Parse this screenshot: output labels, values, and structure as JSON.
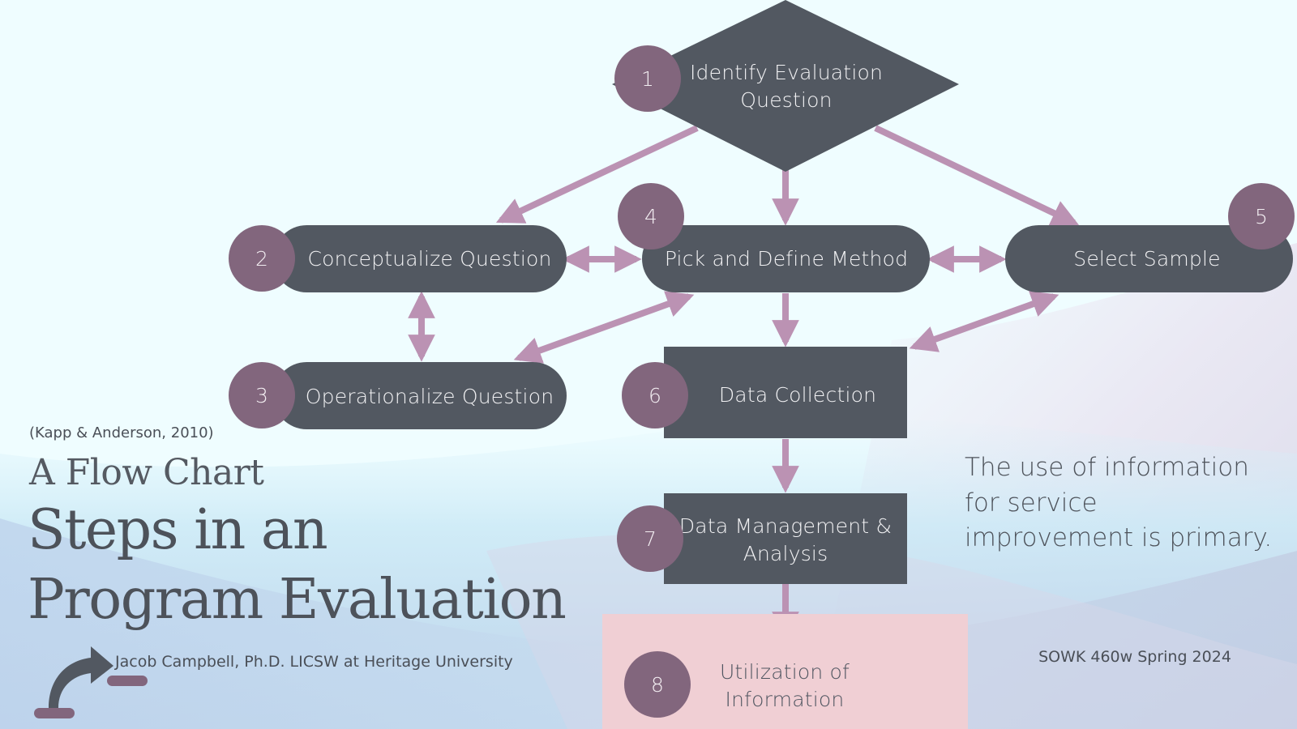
{
  "colors": {
    "background": "#effdff",
    "node_fill": "#525861",
    "badge_fill": "#82667d",
    "arrow": "#bb92b3",
    "highlight_box": "#f0cfd4",
    "text_dark": "#4d525a",
    "text_light": "#f2f2f4"
  },
  "slide": {
    "citation": "(Kapp & Anderson, 2010)",
    "subtitle": "A Flow Chart",
    "title_line1": "Steps in an",
    "title_line2": "Program Evaluation",
    "author": "Jacob Campbell, Ph.D. LICSW at Heritage University",
    "side_note": "The use of information for service improvement is primary.",
    "course": "SOWK 460w Spring 2024",
    "logo_icon": "curved-arrow-step-icon"
  },
  "flowchart": {
    "nodes": [
      {
        "id": "n1",
        "number": "1",
        "label": "Identify Evaluation Question",
        "shape": "diamond"
      },
      {
        "id": "n2",
        "number": "2",
        "label": "Conceptualize Question",
        "shape": "pill"
      },
      {
        "id": "n3",
        "number": "3",
        "label": "Operationalize Question",
        "shape": "pill"
      },
      {
        "id": "n4",
        "number": "4",
        "label": "Pick and Define Method",
        "shape": "pill"
      },
      {
        "id": "n5",
        "number": "5",
        "label": "Select Sample",
        "shape": "pill"
      },
      {
        "id": "n6",
        "number": "6",
        "label": "Data Collection",
        "shape": "rectangle"
      },
      {
        "id": "n7",
        "number": "7",
        "label": "Data Management & Analysis",
        "shape": "rectangle"
      },
      {
        "id": "n8",
        "number": "8",
        "label": "Utilization of Information",
        "shape": "highlight-rectangle"
      }
    ],
    "edges": [
      {
        "from": "n1",
        "to": "n2",
        "direction": "forward"
      },
      {
        "from": "n1",
        "to": "n4",
        "direction": "forward"
      },
      {
        "from": "n1",
        "to": "n5",
        "direction": "forward"
      },
      {
        "from": "n2",
        "to": "n4",
        "direction": "both"
      },
      {
        "from": "n4",
        "to": "n5",
        "direction": "both"
      },
      {
        "from": "n2",
        "to": "n3",
        "direction": "both"
      },
      {
        "from": "n4",
        "to": "n3",
        "direction": "both"
      },
      {
        "from": "n5",
        "to": "n6",
        "direction": "both"
      },
      {
        "from": "n4",
        "to": "n6",
        "direction": "forward"
      },
      {
        "from": "n6",
        "to": "n7",
        "direction": "forward"
      },
      {
        "from": "n7",
        "to": "n8",
        "direction": "forward"
      }
    ]
  }
}
